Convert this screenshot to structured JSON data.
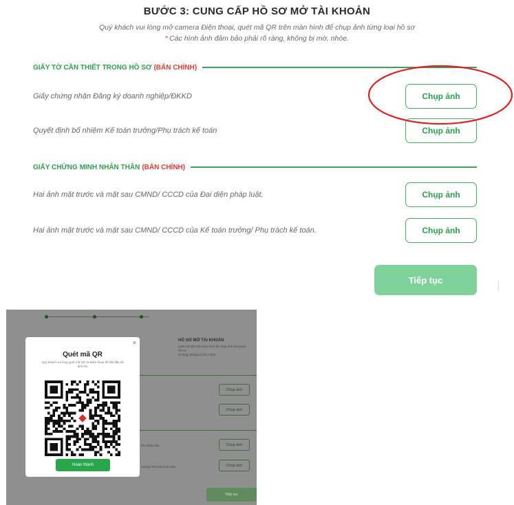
{
  "header": {
    "title": "BƯỚC 3: CUNG CẤP HỒ SƠ MỞ TÀI KHOẢN",
    "subtitle": "Quý khách vui lòng mở camera Điện thoại, quét mã QR trên màn hình để chụp ảnh từng loại hồ sơ",
    "note_mark": "*",
    "note": "Các hình ảnh đảm bảo phải rõ ràng, không bị mờ, nhòe."
  },
  "sections": [
    {
      "title": "GIẤY TỜ CẦN THIẾT TRONG HỒ SƠ",
      "tag": "(BẢN CHÍNH)",
      "items": [
        {
          "label": "Giấy chứng nhận Đăng ký doanh nghiệp/ĐKKD",
          "button": "Chụp ảnh"
        },
        {
          "label": "Quyết định bổ nhiệm Kế toán trưởng/Phụ trách kế toán",
          "button": "Chụp ảnh"
        }
      ]
    },
    {
      "title": "GIẤY CHỨNG MINH NHÂN THÂN",
      "tag": "(BẢN CHÍNH)",
      "items": [
        {
          "label": "Hai ảnh mặt trước và mặt sau CMND/ CCCD của Đại diện pháp luật.",
          "button": "Chụp ảnh"
        },
        {
          "label": "Hai ảnh mặt trước và mặt sau CMND/ CCCD của Kế toán trưởng/ Phụ trách kế toán.",
          "button": "Chụp ảnh"
        }
      ]
    }
  ],
  "continue_label": "Tiếp tục",
  "colors": {
    "accent": "#3fae5f",
    "continue_bg": "#7fd39a",
    "highlight": "#e02020",
    "tag_red": "#e53935"
  },
  "mini": {
    "title": "HỒ SƠ MỞ TÀI KHOẢN",
    "sub_line1": "quét mã QR trên màn hình để chụp ảnh từng loại hồ sơ",
    "sub_line2": "rõ ràng, không bị mờ, nhòe.",
    "label_1": "iện pháp luật.",
    "label_2": "rưởng/ Phụ trách kế toán.",
    "buttons": [
      "Chụp ảnh",
      "Chụp ảnh",
      "Chụp ảnh",
      "Chụp ảnh"
    ],
    "continue_label": "Tiếp tục",
    "modal": {
      "close_icon": "×",
      "title": "Quét mã QR",
      "description": "Quý khách vui lòng quét mã QR từ Điện thoại để bắt đầu tải ảnh lên",
      "done_label": "Hoàn thành"
    }
  }
}
